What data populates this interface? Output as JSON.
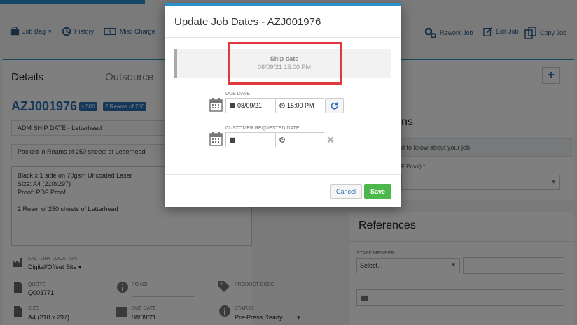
{
  "toolbar": {
    "job_bag": "Job Bag",
    "history": "History",
    "misc_charge": "Misc Charge",
    "rework_job": "Rework Job",
    "edit_job": "Edit Job",
    "copy_job": "Copy Job"
  },
  "tabs": {
    "details": "Details",
    "outsource": "Outsource"
  },
  "job": {
    "number": "AZJ001976",
    "qty_badge": "x 500",
    "reams_badge": "2 Reams of 250",
    "ship_line": "ADM SHIP DATE - Letterhead",
    "packed_line": "Packed in Reams of 250 sheets of Letterhead",
    "description": "Black x 1 side on 70gsm Uncoated Laser\nSize: A4 (210x297)\nProof: PDF Proof\n\n2 Ream of 250 sheets of Letterhead"
  },
  "fields": {
    "factory_location_label": "FACTORY LOCATION",
    "factory_location_value": "Digital/Offset Site",
    "quote_label": "QUOTE",
    "quote_value": "Q003771",
    "po_label": "PO NO.",
    "product_code_label": "PRODUCT CODE",
    "size_label": "SIZE",
    "size_value": "A4 (210 x 297)",
    "due_date_label": "DUE DATE",
    "due_date_value": "08/09/21",
    "status_label": "STATUS",
    "status_value": "Pre-Press Ready"
  },
  "right": {
    "heading_fragment": "ns",
    "info_fragment": "d to know about your job",
    "proof_fragment": "F Proof)",
    "required_mark": "*"
  },
  "references": {
    "title": "References",
    "staff_label": "STAFF MEMBER",
    "staff_select": "Select..."
  },
  "modal": {
    "title": "Update Job Dates - AZJ001976",
    "ship_label": "Ship date",
    "ship_value": "08/09/21 15:00 PM",
    "due_label": "DUE DATE",
    "due_date": "08/09/21",
    "due_time": "15:00 PM",
    "cust_label": "CUSTOMER REQUESTED DATE",
    "cust_date": "",
    "cust_time": "",
    "cancel": "Cancel",
    "save": "Save"
  },
  "colors": {
    "accent": "#2a8fc9",
    "brand_blue": "#2a6fb5",
    "save_green": "#4cb84c",
    "highlight_red": "#e0393e"
  },
  "icons": [
    "briefcase-icon",
    "history-icon",
    "money-icon",
    "gears-icon",
    "edit-icon",
    "copy-icon",
    "calendar-icon",
    "clock-icon",
    "refresh-icon",
    "close-icon",
    "factory-icon",
    "document-icon",
    "info-icon",
    "tag-icon"
  ]
}
